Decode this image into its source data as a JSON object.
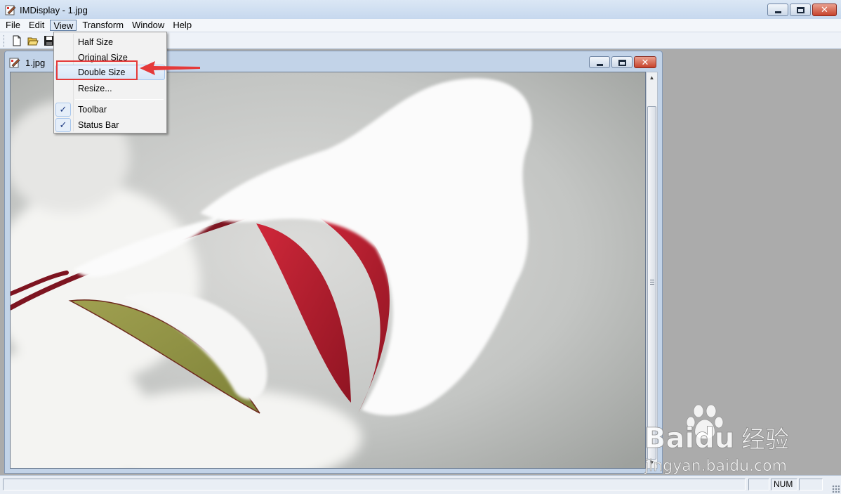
{
  "app": {
    "title": "IMDisplay - 1.jpg"
  },
  "menubar": {
    "items": [
      {
        "label": "File"
      },
      {
        "label": "Edit"
      },
      {
        "label": "View"
      },
      {
        "label": "Transform"
      },
      {
        "label": "Window"
      },
      {
        "label": "Help"
      }
    ],
    "open_menu": "View"
  },
  "toolbar": {
    "buttons": [
      "new-icon",
      "open-icon",
      "save-icon"
    ]
  },
  "view_menu": {
    "items": [
      {
        "label": "Half Size"
      },
      {
        "label": "Original Size"
      },
      {
        "label": "Double Size",
        "highlighted": true
      },
      {
        "label": "Resize..."
      },
      {
        "label": "Toolbar",
        "checked": true
      },
      {
        "label": "Status Bar",
        "checked": true
      }
    ],
    "check_mark": "✓"
  },
  "child_window": {
    "title": "1.jpg",
    "image_description_icon": "photo-snow-red-leaves"
  },
  "statusbar": {
    "main": "",
    "indicators": [
      "",
      "NUM",
      ""
    ]
  },
  "watermark": {
    "brand": "Baidu",
    "brand_cn": "经验",
    "url": "jingyan.baidu.com"
  },
  "colors": {
    "annotation": "#e53a3a",
    "titlebar": "#c6d8ee",
    "mdi_background": "#ababab"
  }
}
